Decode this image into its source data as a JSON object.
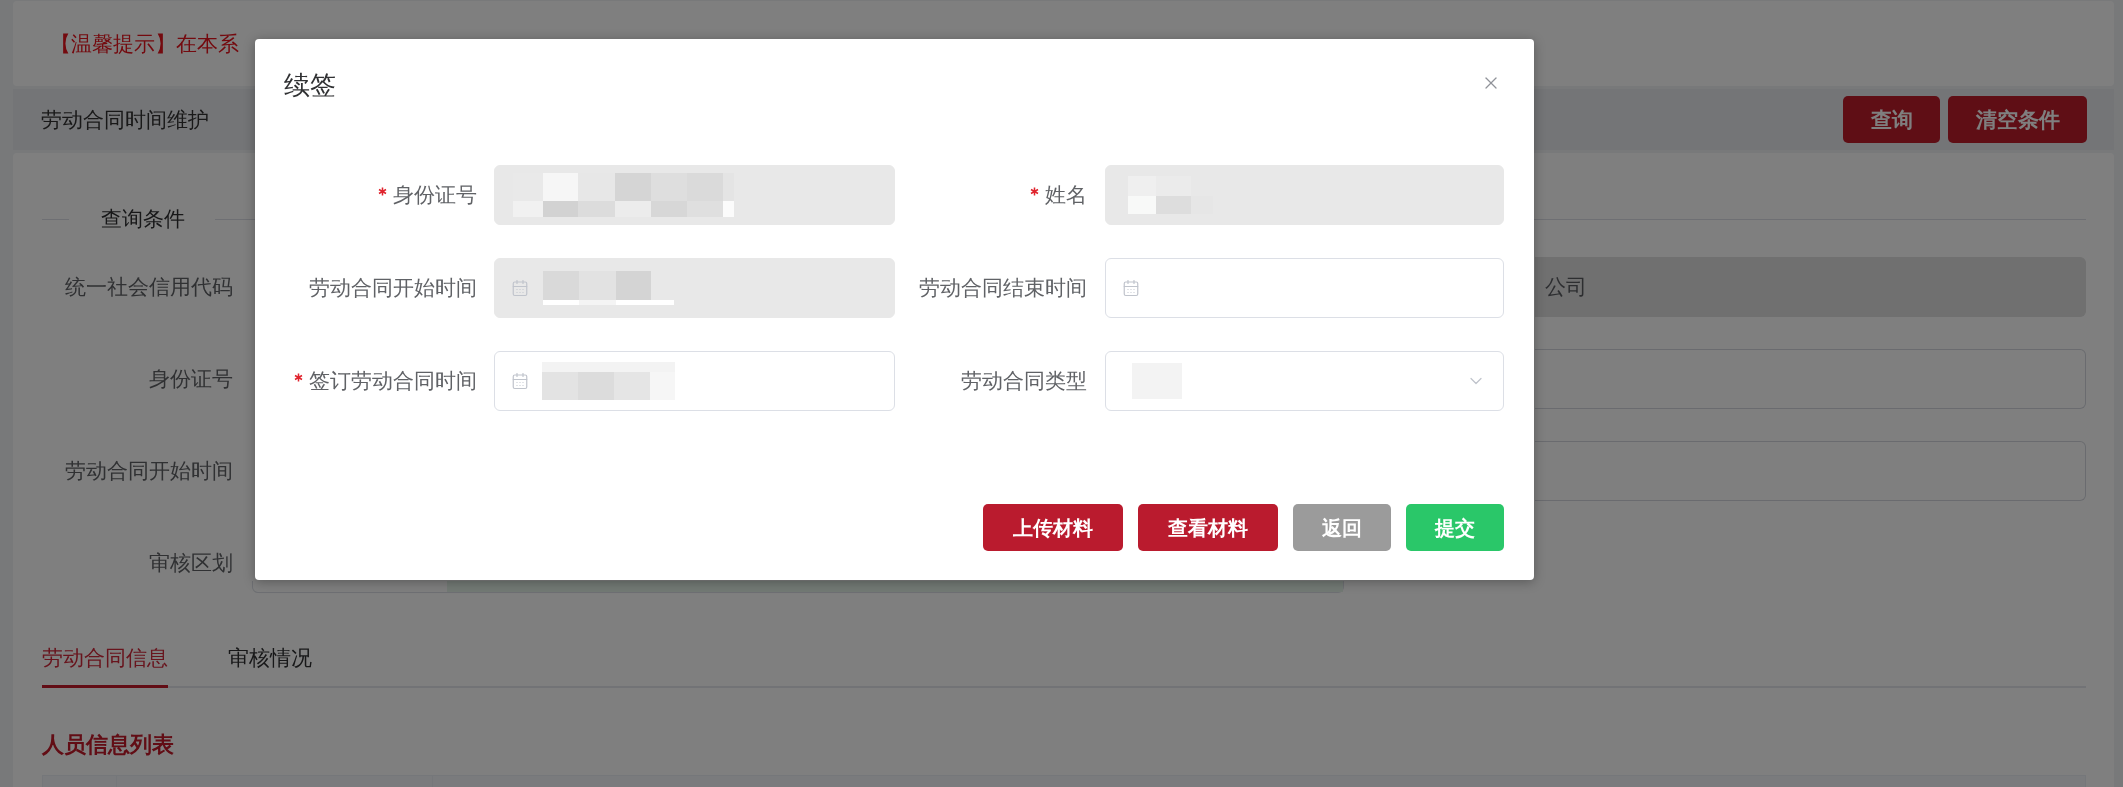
{
  "notice": {
    "text": "【温馨提示】在本系"
  },
  "header": {
    "title": "劳动合同时间维护",
    "buttons": [
      {
        "label": "查询"
      },
      {
        "label": "清空条件"
      }
    ]
  },
  "query_form": {
    "title": "查询条件",
    "rows": [
      {
        "label": "统一社会信用代码",
        "field": {
          "kind": "input",
          "disabled": true,
          "value": "公司"
        }
      },
      {
        "label": "身份证号",
        "field": {
          "kind": "input",
          "disabled": false
        }
      },
      {
        "label": "劳动合同开始时间",
        "field": {
          "kind": "input",
          "disabled": false
        }
      },
      {
        "label": "审核区划",
        "field": {
          "kind": "select"
        }
      }
    ]
  },
  "tabs": [
    {
      "label": "劳动合同信息",
      "selected": true
    },
    {
      "label": "审核情况",
      "selected": false
    }
  ],
  "list_title": "人员信息列表",
  "dialog": {
    "title": "续签",
    "fields": [
      {
        "label": "身份证号",
        "required": true,
        "kind": "text",
        "disabled": true,
        "redacted": true
      },
      {
        "label": "姓名",
        "required": true,
        "kind": "text",
        "disabled": true,
        "redacted": true
      },
      {
        "label": "劳动合同开始时间",
        "required": false,
        "kind": "date",
        "disabled": true,
        "redacted": true
      },
      {
        "label": "劳动合同结束时间",
        "required": false,
        "kind": "date",
        "disabled": false,
        "redacted": false
      },
      {
        "label": "签订劳动合同时间",
        "required": true,
        "kind": "date",
        "disabled": false,
        "redacted": true
      },
      {
        "label": "劳动合同类型",
        "required": false,
        "kind": "select",
        "disabled": false,
        "redacted": true
      }
    ],
    "buttons": [
      {
        "label": "上传材料",
        "kind": "danger"
      },
      {
        "label": "查看材料",
        "kind": "danger"
      },
      {
        "label": "返回",
        "kind": "neutral"
      },
      {
        "label": "提交",
        "kind": "success"
      }
    ]
  }
}
